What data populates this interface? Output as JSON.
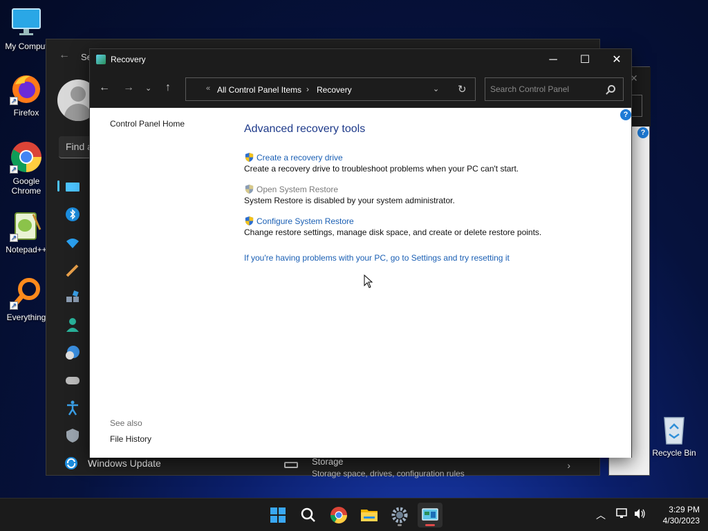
{
  "desktop": {
    "icons": [
      {
        "label": "My Comput",
        "icon": "monitor-icon"
      },
      {
        "label": "Firefox",
        "icon": "firefox-icon"
      },
      {
        "label": "Google Chrome",
        "icon": "chrome-icon"
      },
      {
        "label": "Notepad++",
        "icon": "notepad-plus-plus-icon"
      },
      {
        "label": "Everything",
        "icon": "everything-search-icon"
      },
      {
        "label": "Recycle Bin",
        "icon": "recycle-bin-icon"
      }
    ]
  },
  "settings_window": {
    "title": "Se",
    "find_placeholder": "Find a",
    "windows_update_label": "Windows Update",
    "storage_title": "Storage",
    "storage_subtitle": "Storage space, drives, configuration rules"
  },
  "recovery_window": {
    "title": "Recovery",
    "address": {
      "crumb_prefix": "«",
      "crumb1": "All Control Panel Items",
      "separator": "›",
      "crumb2": "Recovery"
    },
    "search_placeholder": "Search Control Panel",
    "left_nav": {
      "home_link": "Control Panel Home",
      "see_also": "See also",
      "file_history": "File History"
    },
    "heading": "Advanced recovery tools",
    "tasks": [
      {
        "link": "Create a recovery drive",
        "desc": "Create a recovery drive to troubleshoot problems when your PC can't start.",
        "enabled": true
      },
      {
        "link": "Open System Restore",
        "desc": "System Restore is disabled by your system administrator.",
        "enabled": false
      },
      {
        "link": "Configure System Restore",
        "desc": "Change restore settings, manage disk space, and create or delete restore points.",
        "enabled": true
      }
    ],
    "reset_link": "If you're having problems with your PC, go to Settings and try resetting it",
    "help_glyph": "?"
  },
  "taskbar": {
    "apps": [
      "start-icon",
      "search-icon",
      "chrome-icon",
      "file-explorer-icon",
      "settings-gear-icon",
      "control-panel-icon"
    ],
    "time": "3:29 PM",
    "date": "4/30/2023"
  },
  "colors": {
    "link": "#1a5fb4",
    "heading": "#1e3a8a",
    "titlebar": "#1c1c1c",
    "accent": "#4cc2ff"
  }
}
